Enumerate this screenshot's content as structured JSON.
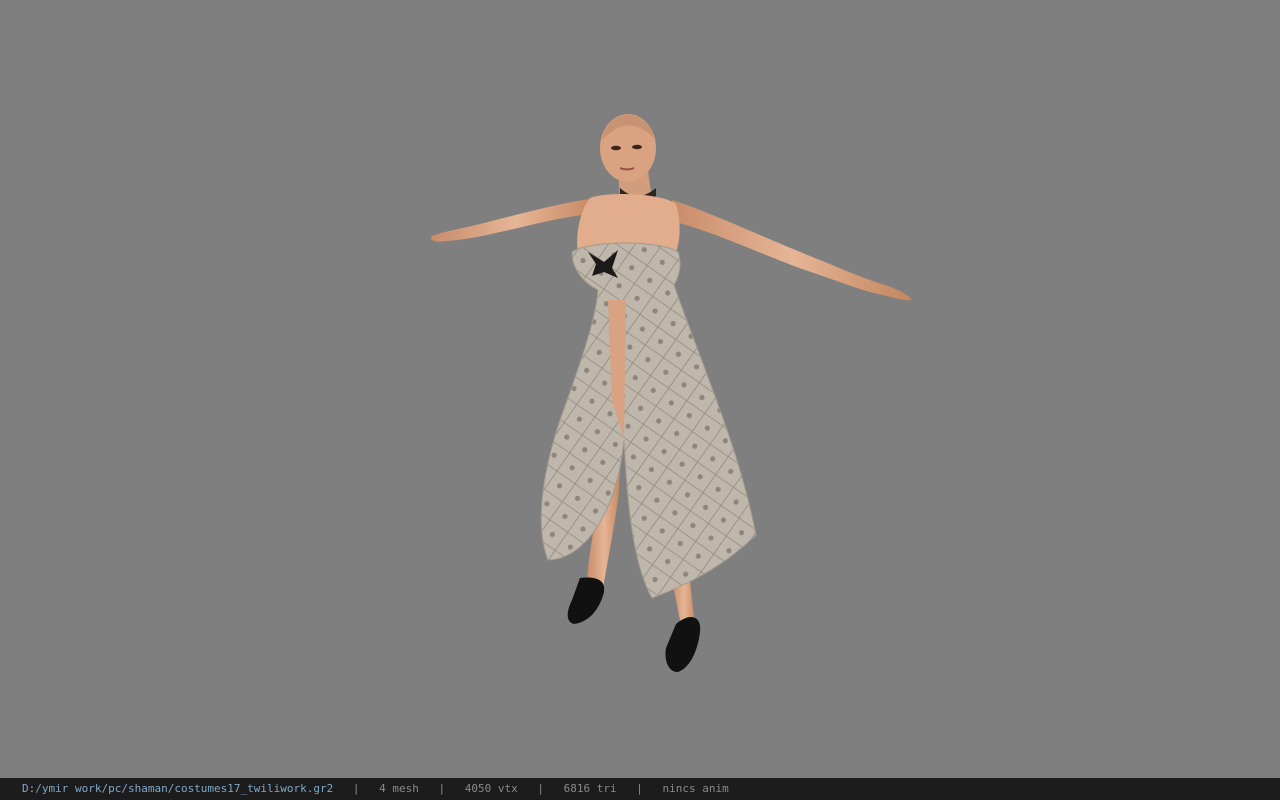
{
  "viewer": {
    "background_color": "#7f7f7f",
    "status_bar": {
      "file_path": "D:/ymir work/pc/shaman/costumes17_twiliwork.gr2",
      "separator": "|",
      "mesh_count": "4 mesh",
      "vertex_count": "4050 vtx",
      "triangle_count": "6816 tri",
      "animation": "nincs anim"
    }
  },
  "model": {
    "description_icon": "character-model",
    "skin_color": "#d9a07e",
    "dress_color": "#bdb5a9",
    "dress_pattern_color": "#8d857b",
    "shoe_color": "#111111",
    "accent_color": "#1a1a1a"
  }
}
